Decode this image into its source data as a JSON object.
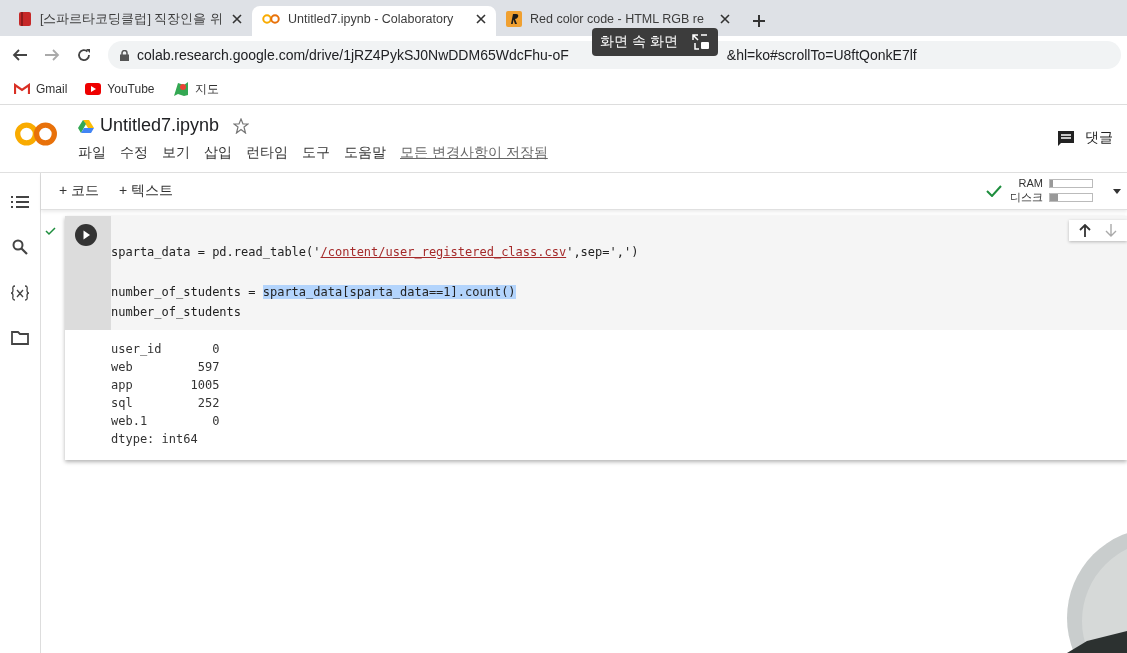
{
  "browser": {
    "tabs": [
      {
        "title": "[스파르타코딩클럽] 직장인을 위",
        "selected": false
      },
      {
        "title": "Untitled7.ipynb - Colaboratory",
        "selected": true
      },
      {
        "title": "Red color code - HTML RGB re",
        "selected": false
      }
    ],
    "url_parts": [
      "colab.research.google.com/drive/1jRZ4PykSJ0NwDDM65WdcFhu-oF",
      "&hl=ko#scrollTo=U8ftQonkE7lf"
    ],
    "tooltip": "화면 속 화면",
    "bookmarks": [
      {
        "label": "Gmail"
      },
      {
        "label": "YouTube"
      },
      {
        "label": "지도"
      }
    ]
  },
  "notebook": {
    "title": "Untitled7.ipynb",
    "menu": [
      "파일",
      "수정",
      "보기",
      "삽입",
      "런타임",
      "도구",
      "도움말"
    ],
    "save_status": "모든 변경사항이 저장됨",
    "comment_button": "댓글",
    "toolbar": [
      "+ 코드",
      "+ 텍스트"
    ],
    "ram_label": "RAM",
    "ram": {
      "level": 0.08
    },
    "disk_label": "디스크",
    "disk": {
      "level": 0.2
    }
  },
  "cell": {
    "code_lines": [
      [
        {
          "kind": "plain",
          "text": "sparta_data = pd.read_table('"
        },
        {
          "kind": "link",
          "text": "/content/user_registered_class.csv"
        },
        {
          "kind": "plain",
          "text": "',sep=',')"
        }
      ],
      [
        {
          "kind": "plain",
          "text": "number_of_students = "
        },
        {
          "kind": "selected",
          "text": "sparta_data[sparta_data==1].count()"
        }
      ],
      [
        {
          "kind": "plain",
          "text": "number_of_students"
        }
      ]
    ],
    "output_lines": [
      "user_id       0",
      "web         597",
      "app        1005",
      "sql         252",
      "web.1         0",
      "dtype: int64"
    ]
  }
}
